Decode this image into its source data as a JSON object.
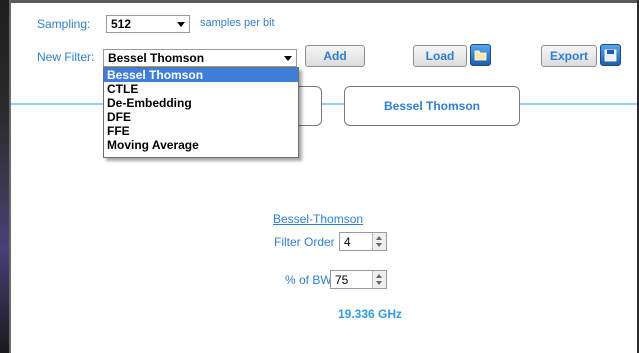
{
  "sampling": {
    "label": "Sampling:",
    "value": "512",
    "suffix": "samples per bit"
  },
  "new_filter": {
    "label": "New Filter:",
    "value": "Bessel Thomson"
  },
  "buttons": {
    "add": "Add",
    "load": "Load",
    "export": "Export"
  },
  "dropdown": {
    "options": [
      "Bessel Thomson",
      "CTLE",
      "De-Embedding",
      "DFE",
      "FFE",
      "Moving Average"
    ],
    "selected_index": 0
  },
  "chain": {
    "filter_block_label": "Bessel Thomson"
  },
  "panel": {
    "title": "Bessel-Thomson",
    "filter_order_label": "Filter Order",
    "filter_order_value": "4",
    "bw_label": "% of BW",
    "bw_value": "75",
    "frequency": "19.336 GHz"
  },
  "colors": {
    "accent": "#2f7fd1",
    "line": "#8ed0f5",
    "selection": "#3d7fd6"
  },
  "icons": {
    "load": "folder-icon",
    "export": "save-icon"
  }
}
